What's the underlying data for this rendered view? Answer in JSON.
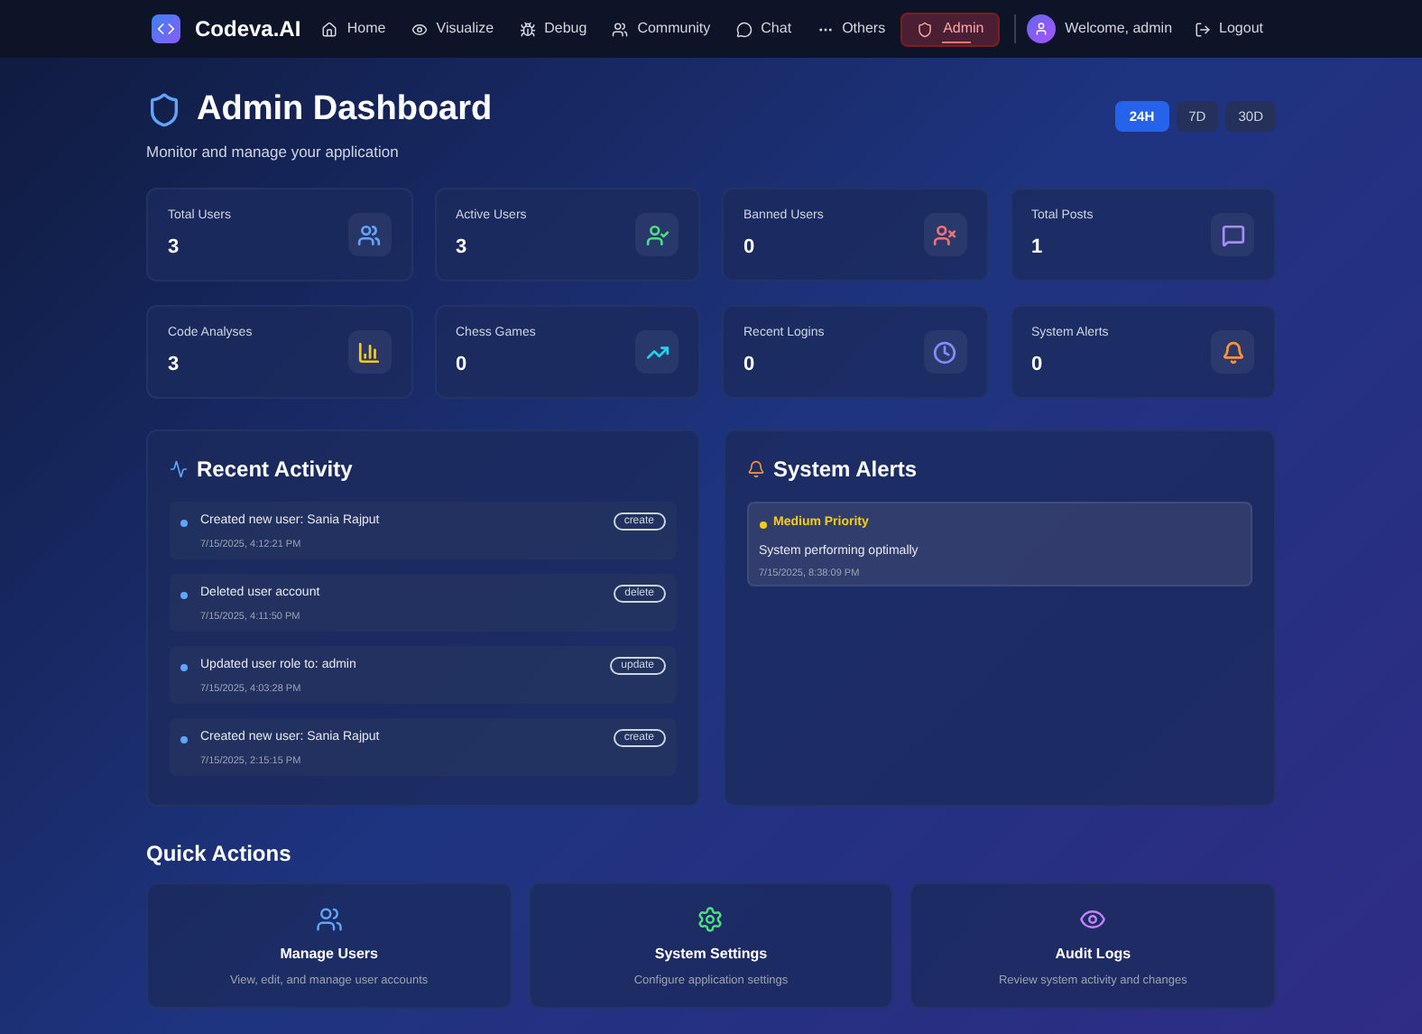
{
  "brand": {
    "name": "Codeva.AI"
  },
  "nav": [
    {
      "label": "Home",
      "selected": false
    },
    {
      "label": "Visualize",
      "selected": false
    },
    {
      "label": "Debug",
      "selected": false
    },
    {
      "label": "Community",
      "selected": false
    },
    {
      "label": "Chat",
      "selected": false
    },
    {
      "label": "Others",
      "selected": false
    },
    {
      "label": "Admin",
      "selected": true
    }
  ],
  "user": {
    "welcome": "Welcome, admin",
    "logout": "Logout"
  },
  "header": {
    "title": "Admin Dashboard",
    "subtitle": "Monitor and manage your application"
  },
  "ranges": [
    {
      "label": "24H",
      "selected": true
    },
    {
      "label": "7D",
      "selected": false
    },
    {
      "label": "30D",
      "selected": false
    }
  ],
  "stats": [
    {
      "label": "Total Users",
      "value": "3",
      "color": "#60a5fa"
    },
    {
      "label": "Active Users",
      "value": "3",
      "color": "#4ade80"
    },
    {
      "label": "Banned Users",
      "value": "0",
      "color": "#f87171"
    },
    {
      "label": "Total Posts",
      "value": "1",
      "color": "#a78bfa"
    },
    {
      "label": "Code Analyses",
      "value": "3",
      "color": "#facc15"
    },
    {
      "label": "Chess Games",
      "value": "0",
      "color": "#22d3ee"
    },
    {
      "label": "Recent Logins",
      "value": "0",
      "color": "#818cf8"
    },
    {
      "label": "System Alerts",
      "value": "0",
      "color": "#fb923c"
    }
  ],
  "recent_activity": {
    "title": "Recent Activity",
    "items": [
      {
        "text": "Created new user: Sania Rajput",
        "time": "7/15/2025, 4:12:21 PM",
        "tag": "create"
      },
      {
        "text": "Deleted user account",
        "time": "7/15/2025, 4:11:50 PM",
        "tag": "delete"
      },
      {
        "text": "Updated user role to: admin",
        "time": "7/15/2025, 4:03:28 PM",
        "tag": "update"
      },
      {
        "text": "Created new user: Sania Rajput",
        "time": "7/15/2025, 2:15:15 PM",
        "tag": "create"
      }
    ]
  },
  "system_alerts": {
    "title": "System Alerts",
    "items": [
      {
        "priority": "Medium Priority",
        "color": "#facc15",
        "message": "System performing optimally",
        "time": "7/15/2025, 8:38:09 PM"
      }
    ]
  },
  "quick_actions": {
    "title": "Quick Actions",
    "items": [
      {
        "title": "Manage Users",
        "description": "View, edit, and manage user accounts",
        "color": "#60a5fa"
      },
      {
        "title": "System Settings",
        "description": "Configure application settings",
        "color": "#4ade80"
      },
      {
        "title": "Audit Logs",
        "description": "Review system activity and changes",
        "color": "#c084fc"
      }
    ]
  }
}
